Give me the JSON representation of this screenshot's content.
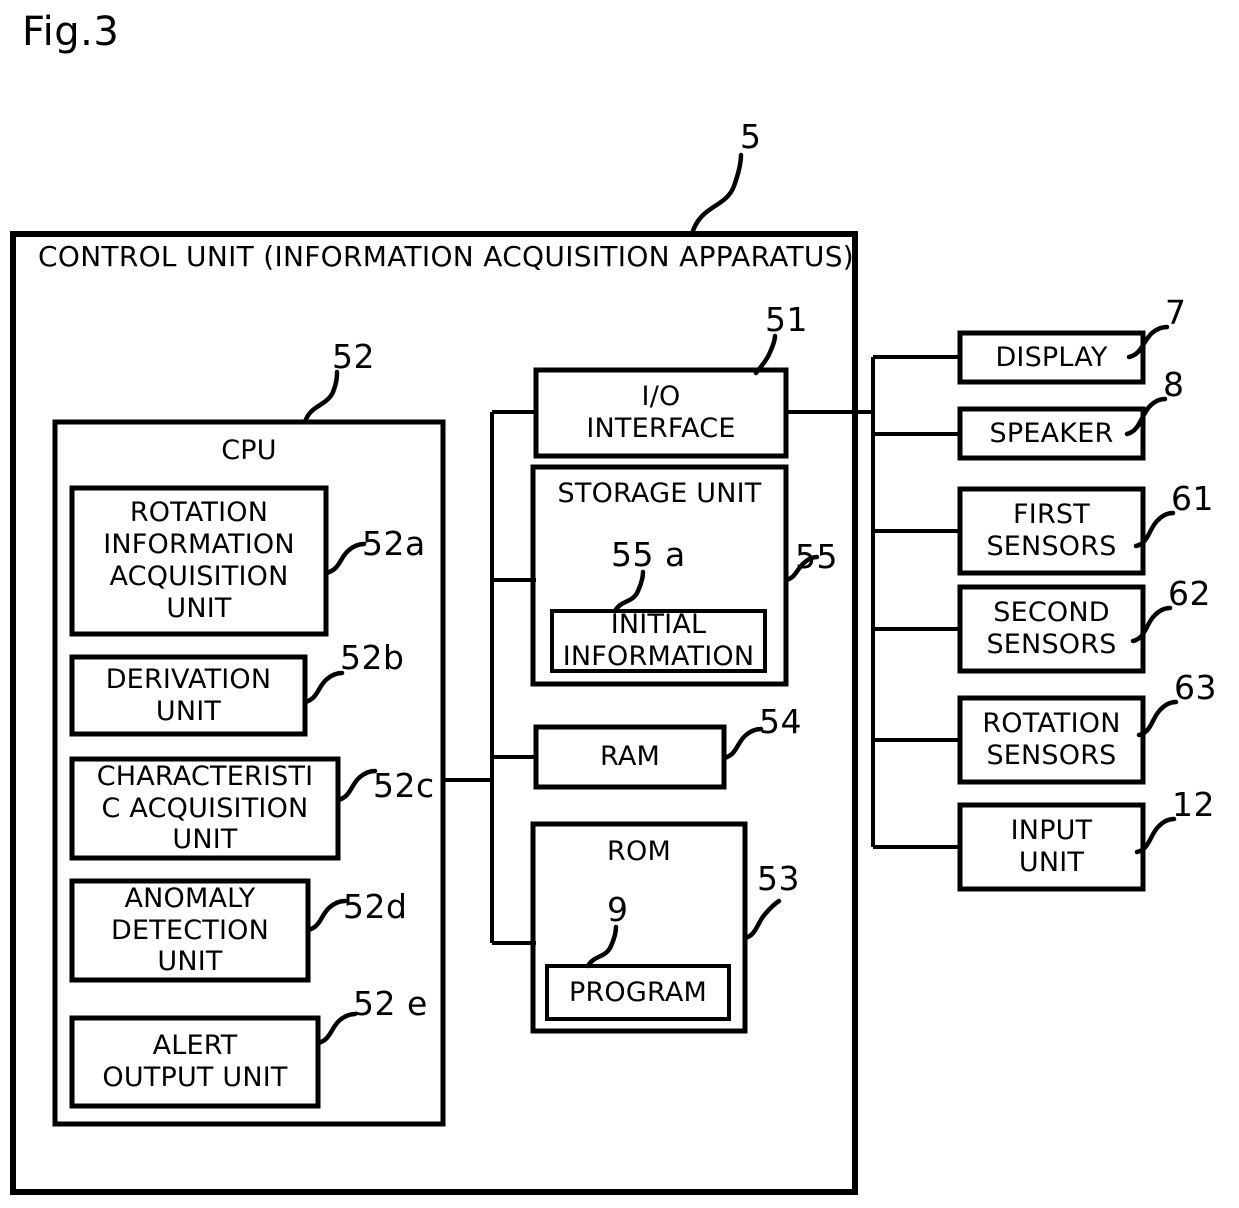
{
  "figure": {
    "caption": "Fig.3",
    "title_ref": "5",
    "outer_box_label": "CONTROL UNIT (INFORMATION ACQUISITION APPARATUS)"
  },
  "cpu": {
    "label": "CPU",
    "ref": "52",
    "blocks": [
      {
        "label": "ROTATION\nINFORMATION\nACQUISITION\nUNIT",
        "ref": "52a"
      },
      {
        "label": "DERIVATION\nUNIT",
        "ref": "52b"
      },
      {
        "label": "CHARACTERISTI\nC ACQUISITION\nUNIT",
        "ref": "52c"
      },
      {
        "label": "ANOMALY\nDETECTION\nUNIT",
        "ref": "52d"
      },
      {
        "label": "ALERT\nOUTPUT UNIT",
        "ref": "52 e"
      }
    ]
  },
  "middle": {
    "io_interface": {
      "label": "I/O\nINTERFACE",
      "ref": "51"
    },
    "storage_unit": {
      "label": "STORAGE UNIT",
      "ref": "55",
      "inner": {
        "label": "INITIAL\nINFORMATION",
        "ref": "55 a"
      }
    },
    "ram": {
      "label": "RAM",
      "ref": "54"
    },
    "rom": {
      "label": "ROM",
      "ref": "53",
      "inner": {
        "label": "PROGRAM",
        "ref": "9"
      }
    }
  },
  "peripherals": [
    {
      "label": "DISPLAY",
      "ref": "7"
    },
    {
      "label": "SPEAKER",
      "ref": "8"
    },
    {
      "label": "FIRST\nSENSORS",
      "ref": "61"
    },
    {
      "label": "SECOND\nSENSORS",
      "ref": "62"
    },
    {
      "label": "ROTATION\nSENSORS",
      "ref": "63"
    },
    {
      "label": "INPUT\nUNIT",
      "ref": "12"
    }
  ],
  "colors": {
    "ink": "#000000",
    "paper": "#ffffff"
  }
}
